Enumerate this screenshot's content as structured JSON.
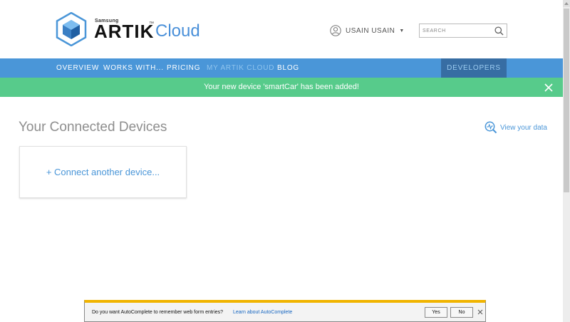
{
  "brand": {
    "samsung": "Samsung",
    "artik": "ARTIK",
    "tm": "™",
    "cloud": "Cloud"
  },
  "user": {
    "name": "USAIN USAIN",
    "icon": "user-avatar-icon"
  },
  "search": {
    "placeholder": "SEARCH",
    "icon": "search-icon"
  },
  "nav": {
    "items": [
      {
        "label": "OVERVIEW"
      },
      {
        "label": "WORKS WITH..."
      },
      {
        "label": "PRICING"
      },
      {
        "label": "MY ARTIK CLOUD"
      },
      {
        "label": "BLOG"
      }
    ],
    "developers": "DEVELOPERS",
    "active": "MY ARTIK CLOUD"
  },
  "notice": {
    "text": "Your new device 'smartCar' has been added!"
  },
  "main": {
    "title": "Your Connected Devices",
    "view_data": "View your data",
    "connect_link": "+ Connect another device..."
  },
  "autocomplete": {
    "question": "Do you want AutoComplete to remember web form entries?",
    "link": "Learn about AutoComplete",
    "yes": "Yes",
    "no": "No"
  },
  "colors": {
    "nav_bg": "#4a96d8",
    "developers_bg": "#376da3",
    "notice_bg": "#57cb8b",
    "accent": "#4a96d8",
    "autocomplete_border": "#f0b400"
  }
}
